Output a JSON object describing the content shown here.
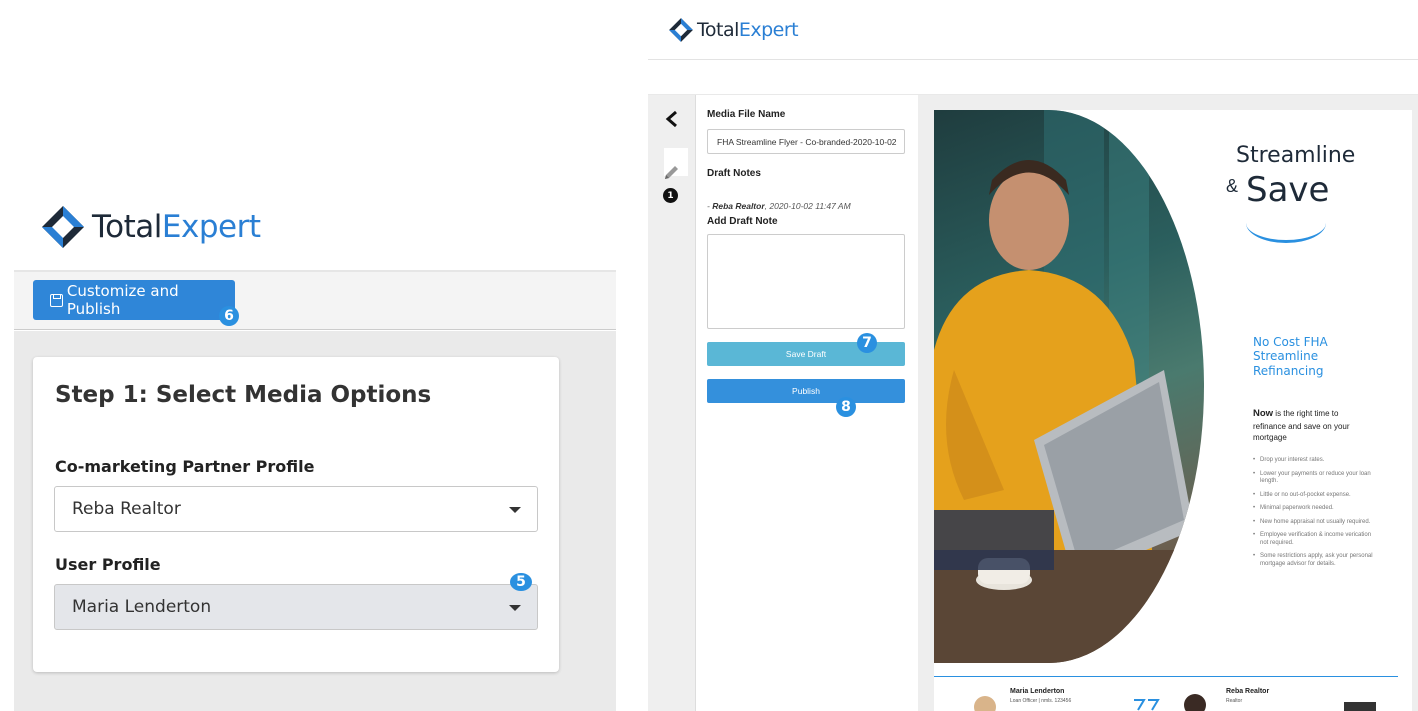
{
  "brand": {
    "name_part1": "Total",
    "name_part2": "Expert",
    "colors": {
      "accent": "#2a7fd4",
      "dark": "#1e2a38",
      "button_blue": "#2f86d8",
      "badge_blue": "#2a90e0",
      "save_draft": "#5ab7d6"
    }
  },
  "left_panel": {
    "toolbar": {
      "customize_publish_label": "Customize and Publish",
      "icon": "floppy-disk-icon"
    },
    "step_title": "Step 1: Select Media Options",
    "partner_profile": {
      "label": "Co-marketing Partner Profile",
      "selected": "Reba Realtor"
    },
    "user_profile": {
      "label": "User Profile",
      "selected": "Maria Lenderton"
    },
    "badges": {
      "customize": "6",
      "user_profile": "5"
    }
  },
  "right_panel": {
    "sidebar": {
      "back_icon": "chevron-left-icon",
      "edit_icon": "pencil-icon",
      "edit_badge": "1"
    },
    "media_file_name": {
      "label": "Media File Name",
      "value": "FHA Streamline Flyer - Co-branded-2020-10-02"
    },
    "draft_notes": {
      "label": "Draft Notes",
      "entries": [
        {
          "author": "Reba Realtor",
          "timestamp": "2020-10-02 11:47 AM"
        }
      ]
    },
    "add_draft_note": {
      "label": "Add Draft Note",
      "value": ""
    },
    "save_draft_label": "Save Draft",
    "publish_label": "Publish",
    "badges": {
      "save_draft": "7",
      "publish": "8"
    }
  },
  "flyer": {
    "headline_line1": "Streamline",
    "headline_amp": "&",
    "headline_line2": "Save",
    "subhead": "No Cost FHA Streamline Refinancing",
    "now_bold": "Now",
    "now_text": " is the right time to refinance and save on your mortgage",
    "bullets": [
      "Drop your interest rates.",
      "Lower your payments or reduce your loan length.",
      "Little or no out-of-pocket expense.",
      "Minimal paperwork needed.",
      "New home appraisal not usually required.",
      "Employee verification & income verication not required.",
      "Some restrictions apply, ask your personal mortgage advisor for details."
    ],
    "agents": [
      {
        "name": "Maria Lenderton",
        "role": "Loan Officer | nmls. 123456"
      },
      {
        "name": "Reba Realtor",
        "role": "Realtor"
      }
    ]
  }
}
